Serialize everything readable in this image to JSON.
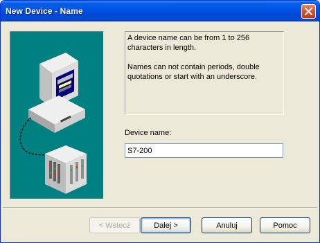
{
  "window": {
    "title": "New Device - Name"
  },
  "info": {
    "text": "A device name can be from 1 to 256 characters in length.\n\nNames can not contain periods, double quotations or start with an underscore."
  },
  "device_name": {
    "label": "Device name:",
    "value": "S7-200"
  },
  "buttons": {
    "back": "< Wstecz",
    "next": "Dalej >",
    "cancel": "Anuluj",
    "help": "Pomoc"
  },
  "colors": {
    "illustration_bg": "#008080",
    "titlebar": "#0055e5",
    "close_button": "#d8512e"
  },
  "icons": {
    "close": "close-icon",
    "illustration": "computer-plc-illustration"
  }
}
